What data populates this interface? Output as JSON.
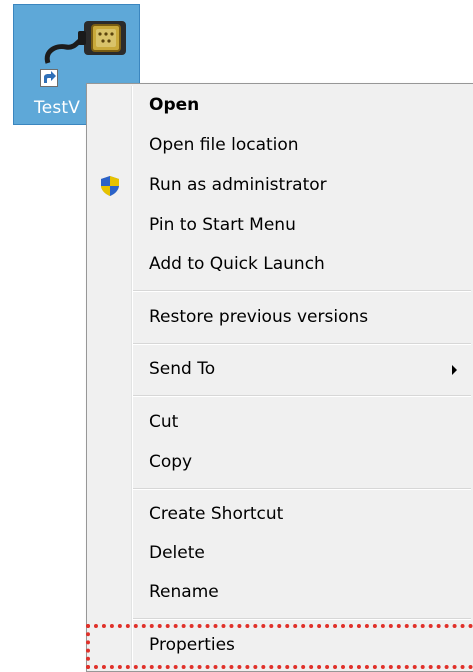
{
  "desktop_shortcut": {
    "label": "TestV",
    "icon": "serial-cable-connector-icon",
    "overlay_icon": "shortcut-arrow-icon",
    "selection_color": "#5ea8d8"
  },
  "context_menu": {
    "items": [
      {
        "label": "Open",
        "bold": true
      },
      {
        "label": "Open file location"
      },
      {
        "label": "Run as administrator",
        "icon": "uac-shield-icon"
      },
      {
        "label": "Pin to Start Menu"
      },
      {
        "label": "Add to Quick Launch"
      },
      {
        "label": "Restore previous versions"
      },
      {
        "label": "Send To",
        "submenu": true
      },
      {
        "label": "Cut"
      },
      {
        "label": "Copy"
      },
      {
        "label": "Create Shortcut"
      },
      {
        "label": "Delete"
      },
      {
        "label": "Rename"
      },
      {
        "label": "Properties",
        "highlighted": true
      }
    ]
  },
  "annotation": {
    "highlight_color": "#e0312a",
    "style": "dotted"
  }
}
